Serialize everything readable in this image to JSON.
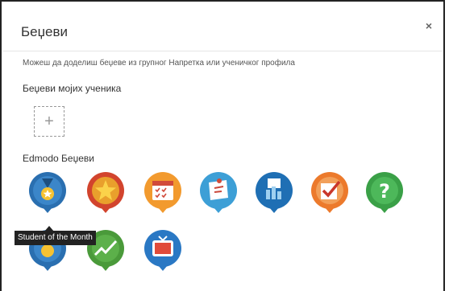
{
  "dialog": {
    "title": "Беџеви",
    "close_label": "×",
    "description": "Можеш да доделиш беџеве из групног Напретка или ученичког профила",
    "my_students_heading": "Беџеви мојих ученика",
    "add_button_label": "+",
    "edmodo_heading": "Edmodo Беџеви"
  },
  "badges": [
    {
      "icon": "medal-icon",
      "color": "#2a6fb0"
    },
    {
      "icon": "star-icon",
      "color": "#d2442d"
    },
    {
      "icon": "calendar-icon",
      "color": "#f29a2e"
    },
    {
      "icon": "note-icon",
      "color": "#3d9fd6"
    },
    {
      "icon": "chart-icon",
      "color": "#1f6fb4"
    },
    {
      "icon": "checkbox-icon",
      "color": "#ec7a2c"
    },
    {
      "icon": "question-icon",
      "color": "#3aa047"
    },
    {
      "icon": "sun-icon",
      "color": "#2a6fb0"
    },
    {
      "icon": "trend-check-icon",
      "color": "#4a9a3a"
    },
    {
      "icon": "tv-icon",
      "color": "#2a78c4"
    }
  ],
  "tooltip": {
    "text": "Student of the Month"
  }
}
